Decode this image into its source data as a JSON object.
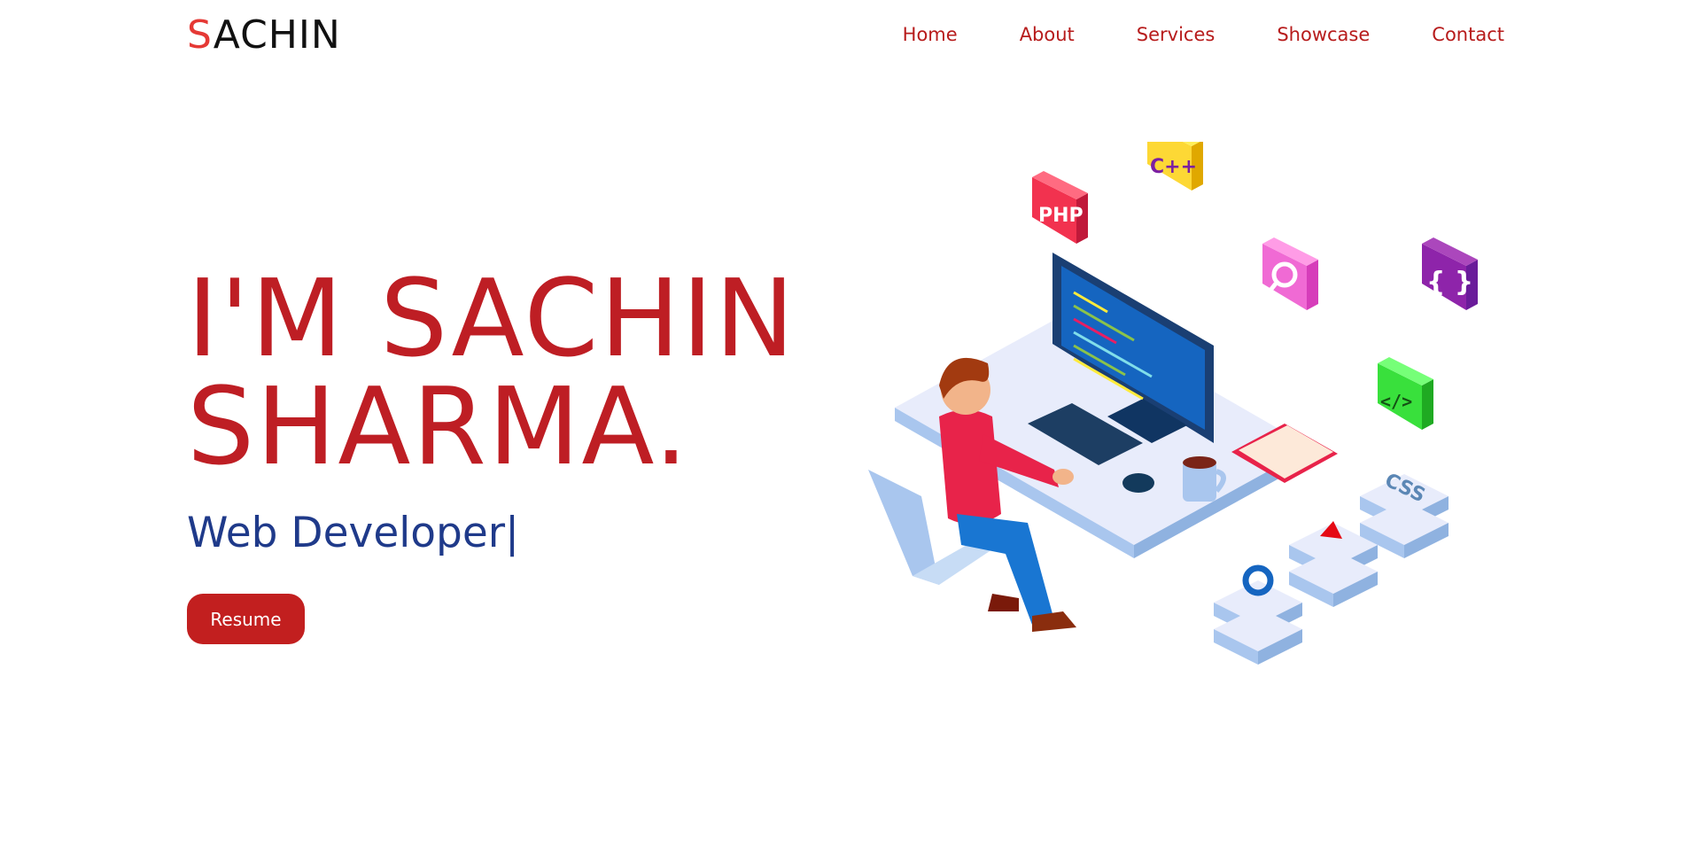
{
  "brand": {
    "logo_first": "S",
    "logo_rest": "ACHIN"
  },
  "nav": {
    "items": [
      {
        "label": "Home"
      },
      {
        "label": "About"
      },
      {
        "label": "Services"
      },
      {
        "label": "Showcase"
      },
      {
        "label": "Contact"
      }
    ]
  },
  "hero": {
    "title_line1": "I'M SACHIN",
    "title_line2": "SHARMA.",
    "subtitle": "Web Developer",
    "cursor": "|",
    "resume_label": "Resume"
  },
  "illustration": {
    "badges": [
      "PHP",
      "C++",
      "CSS",
      "</>",
      "{ }"
    ],
    "icons": [
      "php-badge-icon",
      "cpp-badge-icon",
      "search-badge-icon",
      "braces-badge-icon",
      "code-badge-icon",
      "gear-icon",
      "play-icon",
      "css-icon"
    ],
    "colors": {
      "accent_red": "#be1e24",
      "subtitle_blue": "#1f3a8a",
      "button_red": "#c21f1f"
    }
  }
}
